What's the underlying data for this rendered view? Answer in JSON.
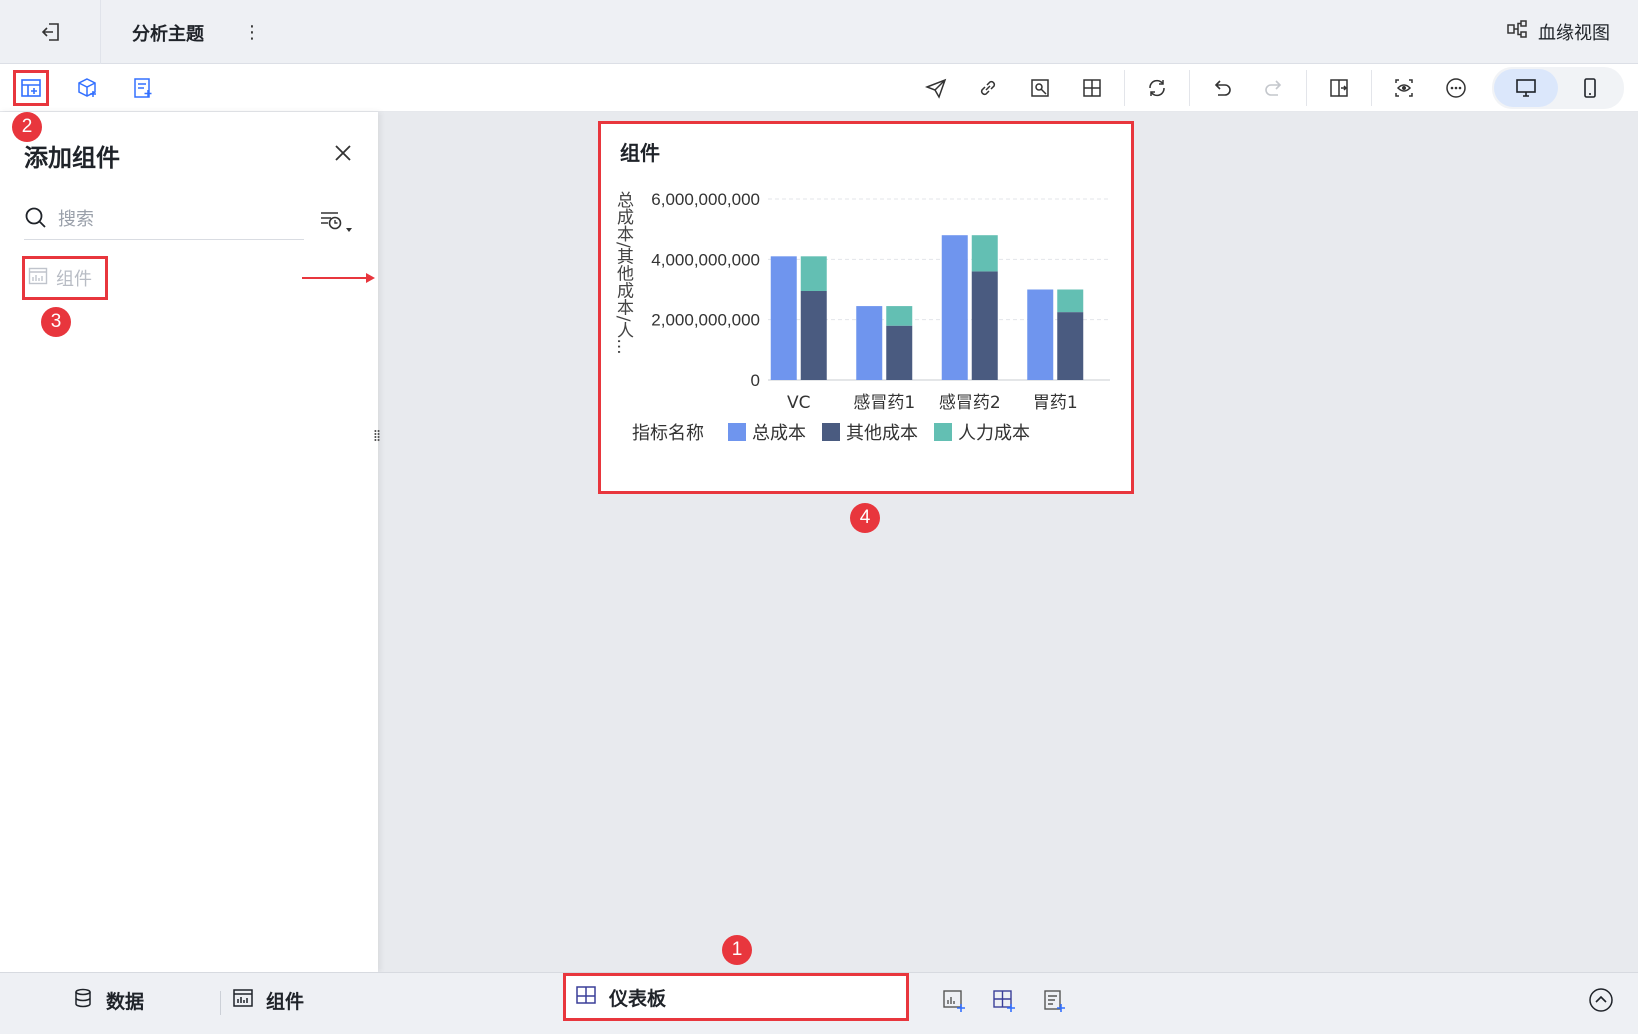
{
  "header": {
    "title": "分析主题",
    "lineage_label": "血缘视图"
  },
  "panel": {
    "title": "添加组件",
    "search_placeholder": "搜索",
    "item_label": "组件"
  },
  "badges": [
    "1",
    "2",
    "3",
    "4"
  ],
  "card": {
    "title": "组件"
  },
  "chart_data": {
    "type": "bar",
    "categories": [
      "VC",
      "感冒药1",
      "感冒药2",
      "胃药1"
    ],
    "ylabel": "总成本/其他成本/人...",
    "yticks": [
      "6,000,000,000",
      "4,000,000,000",
      "2,000,000,000",
      "0"
    ],
    "ylim": [
      0,
      6000000000
    ],
    "legend_title": "指标名称",
    "series": [
      {
        "name": "总成本",
        "color": "#6f95ee",
        "values": [
          4100000000,
          2450000000,
          4800000000,
          3000000000
        ]
      },
      {
        "name": "其他成本",
        "color": "#4a5b80",
        "values": [
          2950000000,
          1800000000,
          3600000000,
          2250000000
        ]
      },
      {
        "name": "人力成本",
        "color": "#63bfb3",
        "values": [
          1150000000,
          650000000,
          1200000000,
          750000000
        ]
      }
    ],
    "stacked_groups": [
      [
        "总成本"
      ],
      [
        "其他成本",
        "人力成本"
      ]
    ],
    "grid": true,
    "legend_position": "bottom-left"
  },
  "bottom": {
    "tab_data": "数据",
    "tab_component": "组件",
    "tab_dashboard": "仪表板"
  },
  "colors": {
    "accent": "#3370ff",
    "highlight": "#e8363d"
  }
}
